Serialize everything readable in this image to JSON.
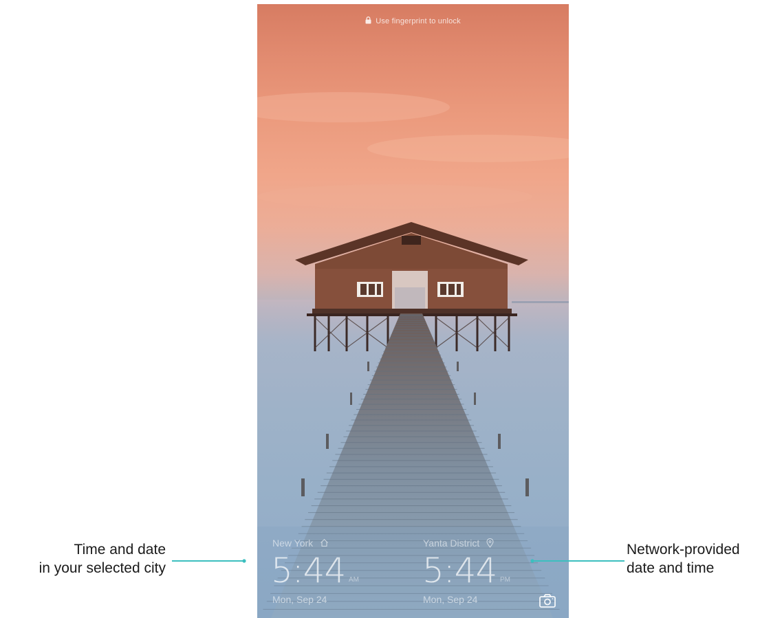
{
  "lock_screen": {
    "unlock_hint": "Use fingerprint to unlock",
    "home_city": {
      "name": "New York",
      "time": "5:44",
      "ampm": "AM",
      "date": "Mon, Sep 24",
      "icon": "home-icon"
    },
    "local_city": {
      "name": "Yanta District",
      "time": "5:44",
      "ampm": "PM",
      "date": "Mon, Sep 24",
      "icon": "location-pin-icon"
    },
    "camera_icon": "camera-icon"
  },
  "callouts": {
    "left_line1": "Time and date",
    "left_line2": "in your selected city",
    "right_line1": "Network-provided",
    "right_line2": "date and time",
    "line_color": "#3cbfbf"
  }
}
